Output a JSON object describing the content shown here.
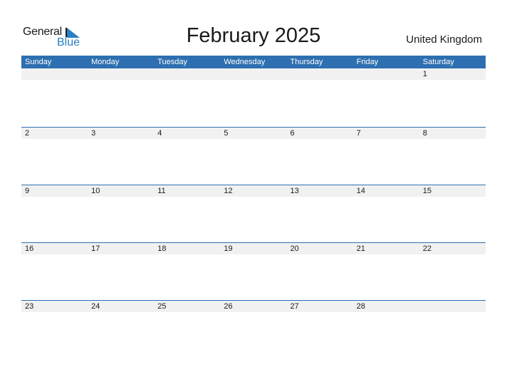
{
  "logo": {
    "line1": "General",
    "line2": "Blue"
  },
  "title": "February 2025",
  "country": "United Kingdom",
  "colors": {
    "accent": "#2d6fb0",
    "strip": "#f1f1f1"
  },
  "weekdays": [
    "Sunday",
    "Monday",
    "Tuesday",
    "Wednesday",
    "Thursday",
    "Friday",
    "Saturday"
  ],
  "weeks": [
    [
      "",
      "",
      "",
      "",
      "",
      "",
      "1"
    ],
    [
      "2",
      "3",
      "4",
      "5",
      "6",
      "7",
      "8"
    ],
    [
      "9",
      "10",
      "11",
      "12",
      "13",
      "14",
      "15"
    ],
    [
      "16",
      "17",
      "18",
      "19",
      "20",
      "21",
      "22"
    ],
    [
      "23",
      "24",
      "25",
      "26",
      "27",
      "28",
      ""
    ]
  ]
}
